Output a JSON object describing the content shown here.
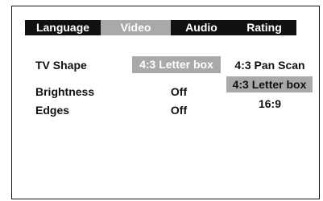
{
  "tabs": [
    {
      "label": "Language",
      "active": false
    },
    {
      "label": "Video",
      "active": true
    },
    {
      "label": "Audio",
      "active": false
    },
    {
      "label": "Rating",
      "active": false
    }
  ],
  "settings": [
    {
      "label": "TV Shape",
      "value": "4:3 Letter box"
    },
    {
      "label": "Brightness",
      "value": "Off"
    },
    {
      "label": "Edges",
      "value": "Off"
    }
  ],
  "tv_shape_options": [
    {
      "label": "4:3 Pan Scan",
      "selected": false
    },
    {
      "label": "4:3 Letter box",
      "selected": true
    },
    {
      "label": "16:9",
      "selected": false
    }
  ],
  "colors": {
    "highlight": "#a9a9a9",
    "bar": "#111111",
    "text": "#111111",
    "background": "#ffffff"
  }
}
